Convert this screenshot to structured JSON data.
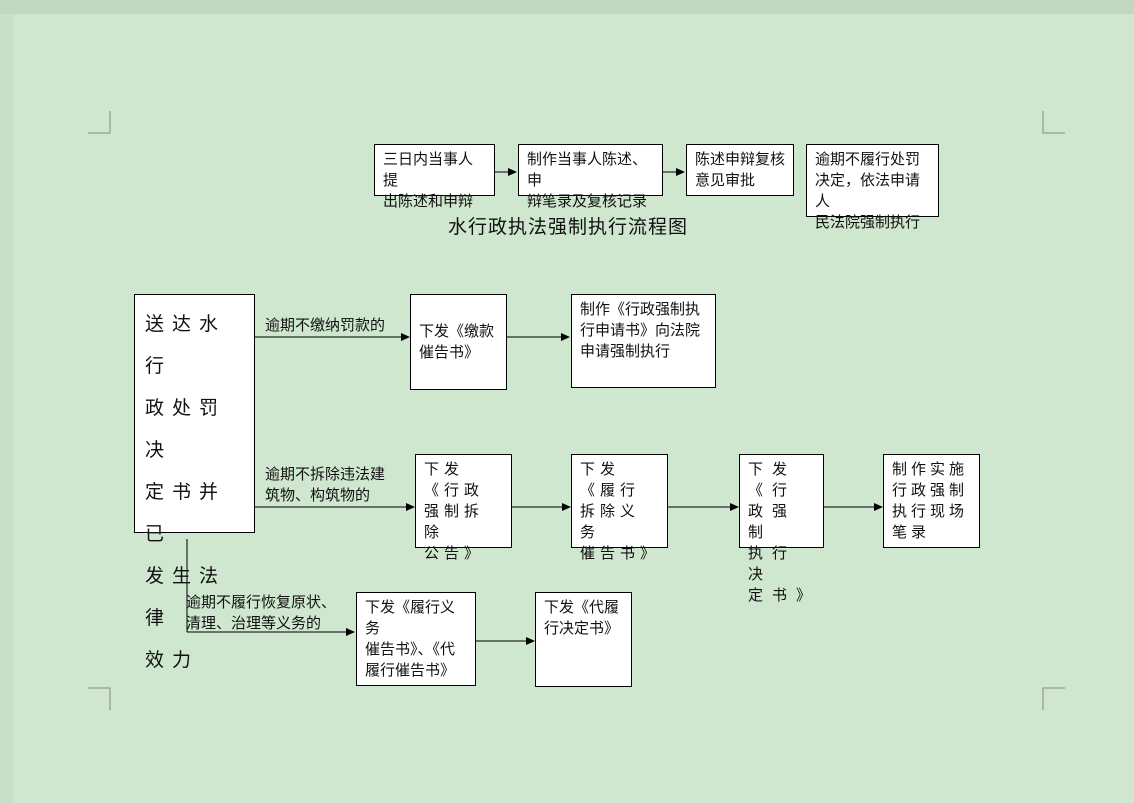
{
  "title": "水行政执法强制执行流程图",
  "top_row": [
    "三日内当事人提\n出陈述和申辩",
    "制作当事人陈述、申\n辩笔录及复核记录",
    "陈述申辩复核\n意见审批",
    "逾期不履行处罚\n决定，依法申请人\n民法院强制执行"
  ],
  "start_box": "送达水行\n政处罚决\n定书并已\n发生法律\n效力",
  "branch1": {
    "label": "逾期不缴纳罚款的",
    "steps": [
      "下发《缴款\n催告书》",
      "制作《行政强制执\n行申请书》向法院\n申请强制执行"
    ]
  },
  "branch2": {
    "label": "逾期不拆除违法建\n筑物、构筑物的",
    "steps": [
      "下发《行政\n强制拆除\n公告》",
      "下发《履行\n拆除义务\n催告书》",
      "下发《行\n政强制\n执行决\n定书》",
      "制作实施\n行政强制\n执行现场\n笔录"
    ]
  },
  "branch3": {
    "label": " 逾期不履行恢复原状、\n清理、治理等义务的",
    "steps": [
      "下发《履行义务\n催告书》、《代\n履行催告书》",
      "下发《代履\n行决定书》"
    ]
  }
}
